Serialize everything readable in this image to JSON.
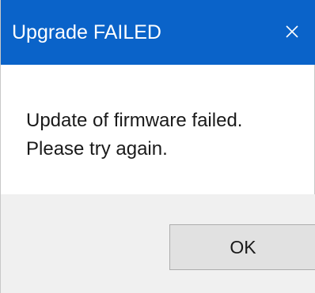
{
  "window": {
    "title": "Upgrade FAILED",
    "close_icon": "close-icon"
  },
  "message": {
    "line1": "Update of firmware failed.",
    "line2": "Please try again."
  },
  "buttons": {
    "ok_label": "OK"
  },
  "colors": {
    "titlebar": "#0a63c9",
    "title_text": "#ffffff",
    "body_bg": "#ffffff",
    "footer_bg": "#f0f0f0",
    "button_bg": "#e1e1e1",
    "button_border": "#adadad"
  }
}
